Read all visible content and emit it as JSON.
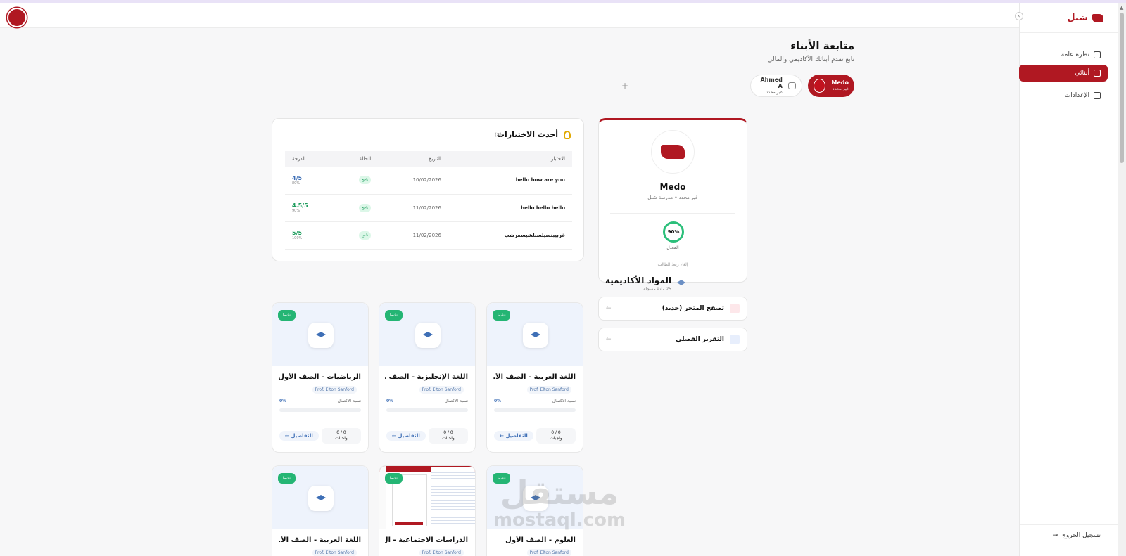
{
  "app": {
    "logo_text": "شبل",
    "brand_color": "#b01822"
  },
  "sidebar": {
    "items": [
      {
        "label": "نظرة عامة",
        "icon": "grid-icon",
        "active": false
      },
      {
        "label": "أبنائي",
        "icon": "users-icon",
        "active": true
      },
      {
        "label": "الإعدادات",
        "icon": "gear-icon",
        "active": false
      }
    ],
    "logout": "تسجيل الخروج"
  },
  "page": {
    "title": "متابعة الأبناء",
    "subtitle": "تابع تقدم أبنائك الأكاديمي والمالي"
  },
  "children": [
    {
      "name": "Medo",
      "status": "غير محدد",
      "selected": true
    },
    {
      "name": "Ahmed A",
      "status": "غير محدد",
      "selected": false
    }
  ],
  "add_child": "+",
  "profile": {
    "name": "Medo",
    "meta": "غير محدد • مدرسة شبل",
    "average": "90%",
    "average_label": "المعدل",
    "unlink": "إلغاء ربط الطالب"
  },
  "actions": [
    {
      "label": "تصفح المتجر (جديد)",
      "icon": "store-icon",
      "color": "#fde7ea"
    },
    {
      "label": "التقرير الفصلي",
      "icon": "document-icon",
      "color": "#e7eefc"
    }
  ],
  "exams": {
    "title": "أحدث الاختبارات",
    "count": "(3)",
    "columns": [
      "الاختبار",
      "التاريخ",
      "الحالة",
      "الدرجة"
    ],
    "rows": [
      {
        "name": "hello how are you",
        "date": "10/02/2026",
        "status": "ناجح",
        "score": "4/5",
        "pct": "80%",
        "score_color": "#3e6fb6"
      },
      {
        "name": "hello hello hello",
        "date": "11/02/2026",
        "status": "ناجح",
        "score": "4.5/5",
        "pct": "90%",
        "score_color": "#1c9c5c"
      },
      {
        "name": "غربيبنسيلسنلشيسمرشب",
        "date": "11/02/2026",
        "status": "ناجح",
        "score": "5/5",
        "pct": "100%",
        "score_color": "#1c9c5c"
      }
    ]
  },
  "subjects": {
    "title": "المواد الأكاديمية",
    "subtitle": "25 مادة مسجلة",
    "cards": [
      {
        "title": "الرياضيات - الصف الأول",
        "teacher": "Prof. Elton Sanford",
        "progress_label": "نسبة الاكتمال",
        "progress": "0%",
        "progress_fraction": 0,
        "homework": "0 / 0",
        "homework_label": "واجبات",
        "details": "التفاصيل",
        "badge": "نشط",
        "screenshot": false
      },
      {
        "title": "اللغة الإنجليزية - الصف ...",
        "teacher": "Prof. Elton Sanford",
        "progress_label": "نسبة الاكتمال",
        "progress": "0%",
        "progress_fraction": 0,
        "homework": "0 / 0",
        "homework_label": "واجبات",
        "details": "التفاصيل",
        "badge": "نشط",
        "screenshot": false
      },
      {
        "title": "اللغة العربية - الصف الأ...",
        "teacher": "Prof. Elton Sanford",
        "progress_label": "نسبة الاكتمال",
        "progress": "0%",
        "progress_fraction": 0,
        "homework": "0 / 0",
        "homework_label": "واجبات",
        "details": "التفاصيل",
        "badge": "نشط",
        "screenshot": false
      },
      {
        "title": "اللغة العربية - الصف الأ...",
        "teacher": "Prof. Elton Sanford",
        "badge": "نشط",
        "screenshot": false
      },
      {
        "title": "الدراسات الاجتماعية - ال...",
        "teacher": "Prof. Elton Sanford",
        "badge": "نشط",
        "screenshot": true
      },
      {
        "title": "العلوم - الصف الأول",
        "teacher": "Prof. Elton Sanford",
        "badge": "نشط",
        "screenshot": false
      }
    ]
  },
  "watermark": {
    "line1": "مستقل",
    "line2": "mostaql.com"
  }
}
